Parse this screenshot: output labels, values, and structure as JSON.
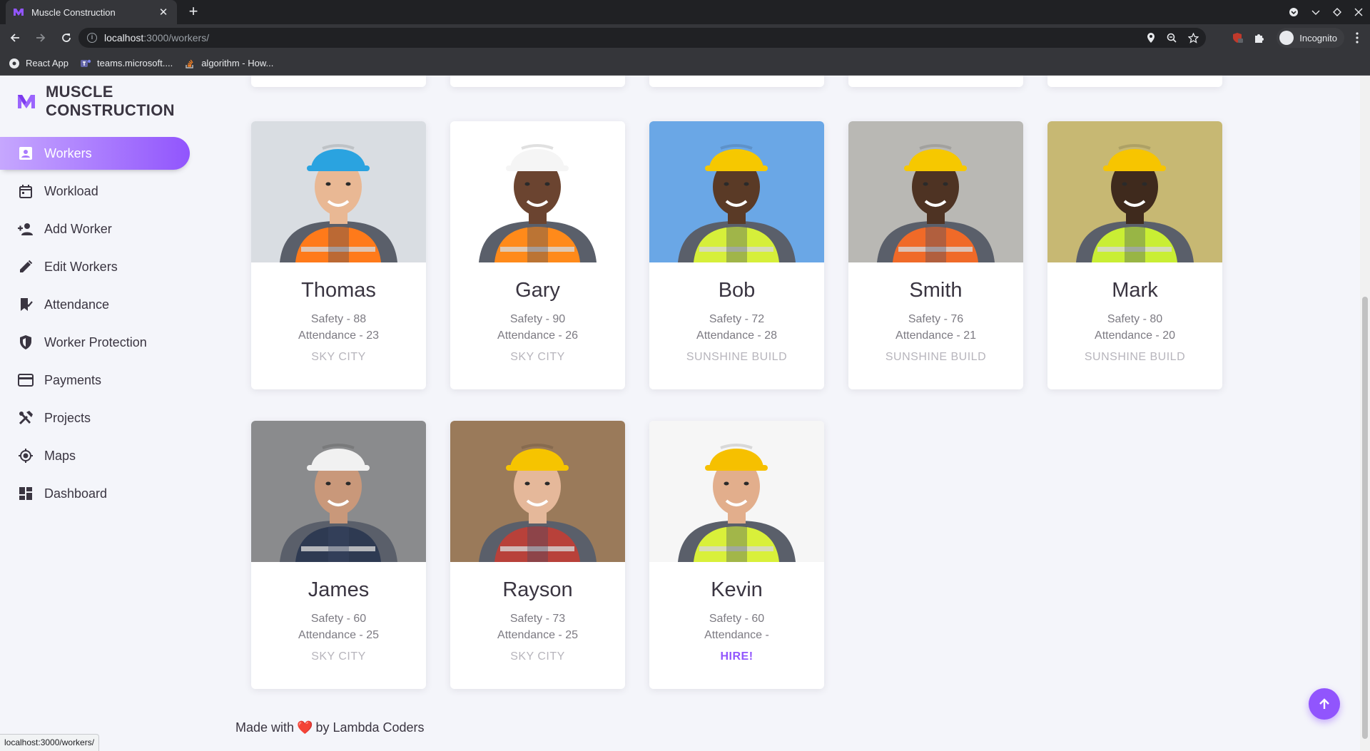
{
  "browser": {
    "tab_title": "Muscle Construction",
    "tab_close": "✕",
    "new_tab": "+",
    "url_host": "localhost",
    "url_path": ":3000/workers/",
    "profile_label": "Incognito",
    "bookmarks": [
      {
        "label": "React App",
        "icon": "react-icon"
      },
      {
        "label": "teams.microsoft....",
        "icon": "teams-icon"
      },
      {
        "label": "algorithm - How...",
        "icon": "stackoverflow-icon"
      }
    ],
    "status_url": "localhost:3000/workers/"
  },
  "brand": {
    "line1": "MUSCLE",
    "line2": "CONSTRUCTION",
    "accent": "#9155fd"
  },
  "sidebar": {
    "items": [
      {
        "label": "Workers",
        "icon": "worker-badge-icon",
        "active": true
      },
      {
        "label": "Workload",
        "icon": "calendar-icon"
      },
      {
        "label": "Add Worker",
        "icon": "add-person-icon"
      },
      {
        "label": "Edit Workers",
        "icon": "pencil-icon"
      },
      {
        "label": "Attendance",
        "icon": "bookmark-check-icon"
      },
      {
        "label": "Worker Protection",
        "icon": "shield-icon"
      },
      {
        "label": "Payments",
        "icon": "credit-card-icon"
      },
      {
        "label": "Projects",
        "icon": "tools-icon"
      },
      {
        "label": "Maps",
        "icon": "location-target-icon"
      },
      {
        "label": "Dashboard",
        "icon": "dashboard-icon"
      }
    ]
  },
  "workers": [
    {
      "name": "Thomas",
      "safety": "Safety - 88",
      "attendance": "Attendance - 23",
      "company": "SKY CITY",
      "helmet": "#2aa3e0",
      "vest": "#ff7a1a",
      "skin": "#e9b894",
      "bg": "#d9dde2"
    },
    {
      "name": "Gary",
      "safety": "Safety - 90",
      "attendance": "Attendance - 26",
      "company": "SKY CITY",
      "helmet": "#f5f5f5",
      "vest": "#ff8a1a",
      "skin": "#6b4430",
      "bg": "#ffffff"
    },
    {
      "name": "Bob",
      "safety": "Safety - 72",
      "attendance": "Attendance - 28",
      "company": "SUNSHINE BUILD",
      "helmet": "#f6c800",
      "vest": "#d6ef3a",
      "skin": "#5a3a26",
      "bg": "#6aa7e6"
    },
    {
      "name": "Smith",
      "safety": "Safety - 76",
      "attendance": "Attendance - 21",
      "company": "SUNSHINE BUILD",
      "helmet": "#f6c800",
      "vest": "#f06a28",
      "skin": "#4e3323",
      "bg": "#b9b8b4"
    },
    {
      "name": "Mark",
      "safety": "Safety - 80",
      "attendance": "Attendance - 20",
      "company": "SUNSHINE BUILD",
      "helmet": "#f7c500",
      "vest": "#c9ee34",
      "skin": "#3f2a1d",
      "bg": "#c7b873"
    },
    {
      "name": "James",
      "safety": "Safety - 60",
      "attendance": "Attendance - 25",
      "company": "SKY CITY",
      "helmet": "#f1f1f1",
      "vest": "#2e3a52",
      "skin": "#c9987a",
      "bg": "#8a8b8d"
    },
    {
      "name": "Rayson",
      "safety": "Safety - 73",
      "attendance": "Attendance - 25",
      "company": "SKY CITY",
      "helmet": "#f6c400",
      "vest": "#b8413a",
      "skin": "#e5b89a",
      "bg": "#9a7a5a"
    },
    {
      "name": "Kevin",
      "safety": "Safety - 60",
      "attendance": "Attendance -",
      "company": "HIRE!",
      "hire": true,
      "helmet": "#f6c000",
      "vest": "#d9f03a",
      "skin": "#e2ae8c",
      "bg": "#f6f6f6"
    }
  ],
  "footer": {
    "prefix": "Made with",
    "heart": "❤️",
    "suffix": "by Lambda Coders"
  }
}
